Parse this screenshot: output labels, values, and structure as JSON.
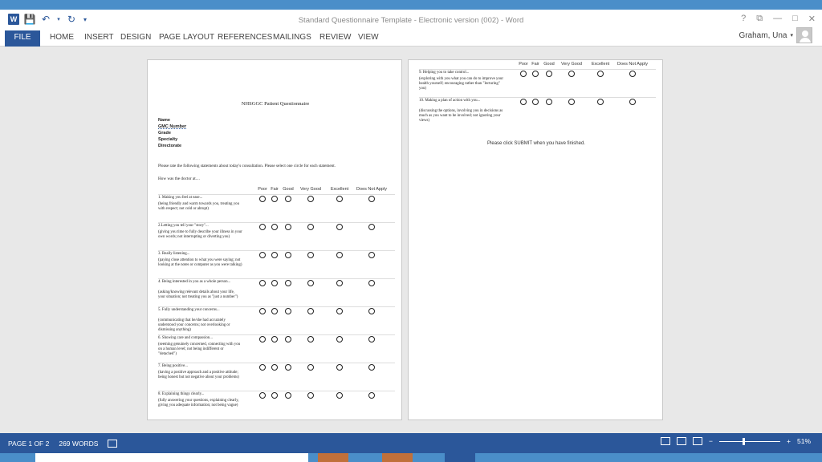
{
  "app": {
    "title": "Standard Questionnaire Template - Electronic version (002) - Word",
    "user": "Graham, Una",
    "window_controls": [
      "?",
      "⧉",
      "—",
      "□",
      "✕"
    ]
  },
  "ribbon": {
    "tabs": [
      "FILE",
      "HOME",
      "INSERT",
      "DESIGN",
      "PAGE LAYOUT",
      "REFERENCES",
      "MAILINGS",
      "REVIEW",
      "VIEW"
    ]
  },
  "page1": {
    "title": "NHSGGC Patient Questionnaire",
    "fields": [
      "Name",
      "GMC Number",
      "Grade",
      "Specialty",
      "Directorate"
    ],
    "intro": "Please rate the following statements about today's consultation.  Please select one circle for each statement.",
    "how_was": "How was the doctor at....",
    "columns": [
      "Poor",
      "Fair",
      "Good",
      "Very Good",
      "Excellent",
      "Does Not Apply"
    ],
    "questions": [
      {
        "title": "1. Making you feel at ease...",
        "detail": "(being friendly and warm towards you, treating you with respect; not cold or abrupt)"
      },
      {
        "title": "2.Letting you tell your \"story\"...",
        "detail": "(giving you time to fully describe your illness in your own words; not interrupting or diverting you)"
      },
      {
        "title": "3. Really listening...",
        "detail": "(paying close attention to what you were saying; not looking at the notes or computer as you were talking)"
      },
      {
        "title": "4. Being interested in you as a whole person...",
        "detail": "(asking/knowing relevant details about your life, your situation; not treating you as \"just a number\")"
      },
      {
        "title": "5. Fully understanding your concerns...",
        "detail": "(communicating that he/she had accurately understood your concerns; not overlooking or dismissing anything)"
      },
      {
        "title": "6. Showing care and compassion...",
        "detail": "(seeming genuinely concerned, connecting with you on a human level; not being indifferent or \"detached\")"
      },
      {
        "title": "7. Being positive...",
        "detail": "(having a positive approach and a positive attitude; being honest but not negative about your problems)"
      },
      {
        "title": "8. Explaining things clearly...",
        "detail": "(fully answering your questions, explaining clearly, giving you adequate information; not being vague)"
      }
    ]
  },
  "page2": {
    "columns": [
      "Poor",
      "Fair",
      "Good",
      "Very Good",
      "Excellent",
      "Does Not Apply"
    ],
    "questions": [
      {
        "title": "9. Helping you to take control...",
        "detail": "(exploring with you what you can do to improve your health yourself; encouraging rather than \"lecturing\" you)"
      },
      {
        "title": "10. Making a plan of action with you...",
        "detail": "(discussing the options, involving you in decisions as much as you want to be involved; not ignoring your views)"
      }
    ],
    "submit": "Please click SUBMIT  when you have finished."
  },
  "status": {
    "page": "PAGE 1 OF 2",
    "words": "269 WORDS",
    "zoom": "51%",
    "zoom_fraction": 0.4
  }
}
